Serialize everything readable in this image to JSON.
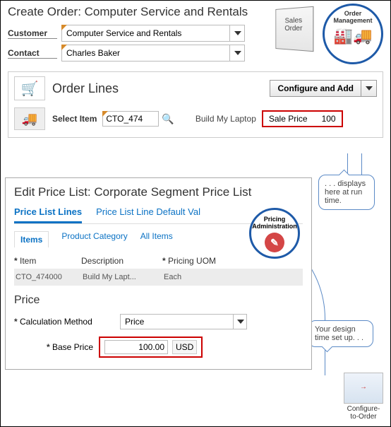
{
  "header": {
    "title": "Create Order: Computer Service and Rentals",
    "sales_order_badge": "Sales\nOrder",
    "order_mgmt_badge": "Order\nManagement"
  },
  "customer": {
    "label": "Customer",
    "value": "Computer Service and Rentals"
  },
  "contact": {
    "label": "Contact",
    "value": "Charles Baker"
  },
  "order_lines": {
    "title": "Order Lines",
    "configure_btn": "Configure and Add",
    "select_item_label": "Select Item",
    "item_value": "CTO_474",
    "build_label": "Build My Laptop",
    "sale_label": "Sale Price",
    "sale_value": "100"
  },
  "callouts": {
    "runtime": ". . . displays here at run time.",
    "designtime": "Your design time set up. . ."
  },
  "pricelist": {
    "title": "Edit Price List: Corporate Segment Price List",
    "tab_lines": "Price List Lines",
    "tab_default": "Price List Line Default Val",
    "badge": "Pricing\nAdministration",
    "sub_items": "Items",
    "sub_cat": "Product Category",
    "sub_all": "All Items",
    "col_item": "Item",
    "col_desc": "Description",
    "col_uom": "Pricing UOM",
    "row": {
      "item": "CTO_474000",
      "desc": "Build My Lapt...",
      "uom": "Each"
    },
    "price_heading": "Price",
    "calc_label": "Calculation Method",
    "calc_value": "Price",
    "base_label": "Base Price",
    "base_value": "100.00",
    "currency": "USD"
  },
  "cto_badge": "Configure-\nto-Order"
}
